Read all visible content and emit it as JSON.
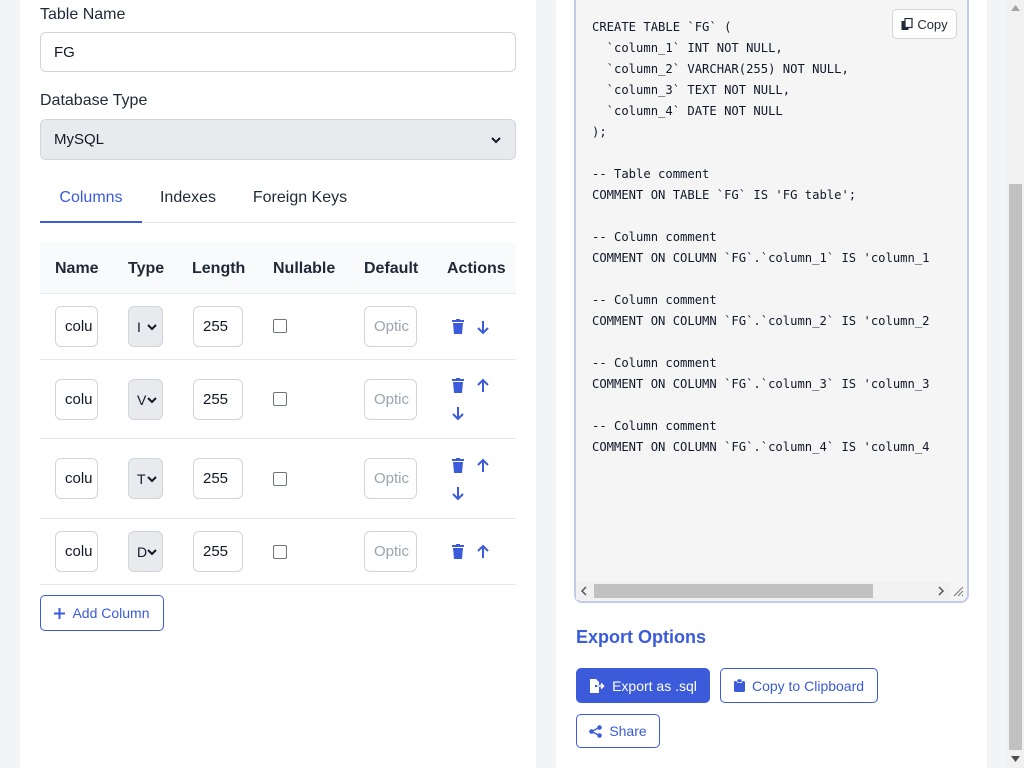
{
  "form": {
    "table_name_label": "Table Name",
    "table_name_value": "FG",
    "db_type_label": "Database Type",
    "db_type_value": "MySQL"
  },
  "tabs": [
    {
      "label": "Columns",
      "active": true
    },
    {
      "label": "Indexes",
      "active": false
    },
    {
      "label": "Foreign Keys",
      "active": false
    }
  ],
  "table": {
    "headers": [
      "Name",
      "Type",
      "Length",
      "Nullable",
      "Default",
      "Actions"
    ],
    "rows": [
      {
        "name": "colu",
        "type": "I",
        "length": "255",
        "default_placeholder": "Optic"
      },
      {
        "name": "colu",
        "type": "V",
        "length": "255",
        "default_placeholder": "Optic"
      },
      {
        "name": "colu",
        "type": "T",
        "length": "255",
        "default_placeholder": "Optic"
      },
      {
        "name": "colu",
        "type": "D",
        "length": "255",
        "default_placeholder": "Optic"
      }
    ]
  },
  "add_column_label": "Add Column",
  "code": {
    "copy_label": "Copy",
    "text": "CREATE TABLE `FG` (\n  `column_1` INT NOT NULL,\n  `column_2` VARCHAR(255) NOT NULL,\n  `column_3` TEXT NOT NULL,\n  `column_4` DATE NOT NULL\n);\n\n-- Table comment\nCOMMENT ON TABLE `FG` IS 'FG table';\n\n-- Column comment\nCOMMENT ON COLUMN `FG`.`column_1` IS 'column_1\n\n-- Column comment\nCOMMENT ON COLUMN `FG`.`column_2` IS 'column_2\n\n-- Column comment\nCOMMENT ON COLUMN `FG`.`column_3` IS 'column_3\n\n-- Column comment\nCOMMENT ON COLUMN `FG`.`column_4` IS 'column_4"
  },
  "export": {
    "title": "Export Options",
    "export_sql_label": "Export as .sql",
    "copy_clipboard_label": "Copy to Clipboard",
    "share_label": "Share"
  },
  "colors": {
    "accent": "#3b5bdb",
    "icon": "#3b5bdb"
  }
}
